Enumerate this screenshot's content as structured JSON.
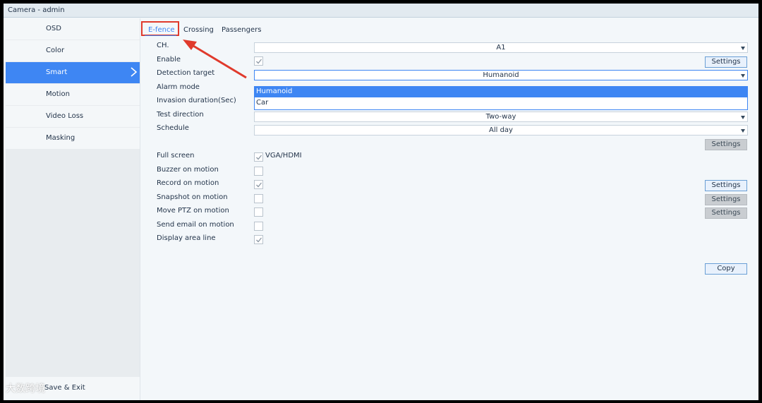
{
  "window": {
    "title": "Camera - admin"
  },
  "sidebar": {
    "items": [
      {
        "label": "OSD"
      },
      {
        "label": "Color"
      },
      {
        "label": "Smart",
        "active": true
      },
      {
        "label": "Motion"
      },
      {
        "label": "Video Loss"
      },
      {
        "label": "Masking"
      }
    ],
    "bottom_label": "Save & Exit"
  },
  "tabs": [
    {
      "label": "E-fence",
      "active": true
    },
    {
      "label": "Crossing"
    },
    {
      "label": "Passengers"
    }
  ],
  "form": {
    "ch": {
      "label": "CH.",
      "value": "A1"
    },
    "enable": {
      "label": "Enable",
      "checked": true,
      "button": "Settings"
    },
    "detection_target": {
      "label": "Detection target",
      "value": "Humanoid",
      "options": [
        "Humanoid",
        "Car"
      ],
      "highlighted_option": "Humanoid"
    },
    "alarm_mode": {
      "label": "Alarm mode"
    },
    "invasion_duration": {
      "label": "Invasion duration(Sec)"
    },
    "test_direction": {
      "label": "Test direction",
      "value": "Two-way"
    },
    "schedule": {
      "label": "Schedule",
      "value": "All day",
      "button": "Settings"
    },
    "full_screen": {
      "label": "Full screen",
      "checked": true,
      "suffix": "VGA/HDMI"
    },
    "buzzer": {
      "label": "Buzzer on motion",
      "checked": false
    },
    "record": {
      "label": "Record on motion",
      "checked": true,
      "button": "Settings"
    },
    "snapshot": {
      "label": "Snapshot on motion",
      "checked": false,
      "button": "Settings"
    },
    "move_ptz": {
      "label": "Move PTZ on motion",
      "checked": false,
      "button": "Settings"
    },
    "send_email": {
      "label": "Send email on motion",
      "checked": false
    },
    "display_area_line": {
      "label": "Display area line",
      "checked": true
    }
  },
  "copy_button": "Copy",
  "watermark": "大数跨境",
  "colors": {
    "accent": "#3e86f3",
    "annotation": "#e03a2c"
  },
  "icons": {
    "sidebar_active": "chevron-right-icon",
    "checkbox": "checkmark-icon",
    "select": "caret-down-icon"
  }
}
